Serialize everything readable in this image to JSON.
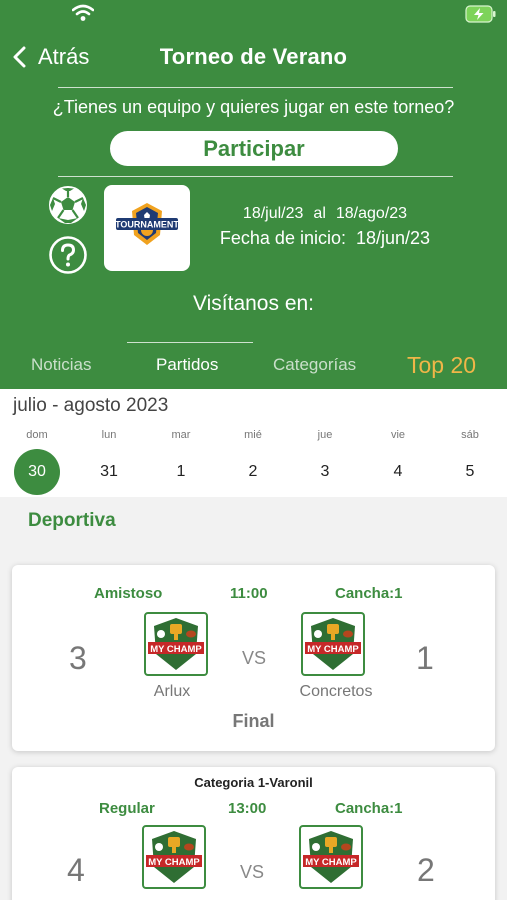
{
  "nav": {
    "back_label": "Atrás",
    "title": "Torneo de Verano"
  },
  "tournament": {
    "question": "¿Tienes un equipo y quieres jugar en este torneo?",
    "participate_label": "Participar",
    "logo_text": "TOURNAMENT",
    "date_from": "18/jul/23",
    "date_sep": "al",
    "date_to": "18/ago/23",
    "start_label": "Fecha de inicio:",
    "start_date": "18/jun/23",
    "visit_label": "Visítanos en:"
  },
  "tabs": [
    {
      "label": "Noticias"
    },
    {
      "label": "Partidos"
    },
    {
      "label": "Categorías"
    },
    {
      "label": "Top 20"
    }
  ],
  "calendar": {
    "month_label": "julio - agosto 2023",
    "weekdays": [
      "dom",
      "lun",
      "mar",
      "mié",
      "jue",
      "vie",
      "sáb"
    ],
    "days": [
      "30",
      "31",
      "1",
      "2",
      "3",
      "4",
      "5"
    ],
    "selected_index": 0
  },
  "section_title": "Deportiva",
  "matches": [
    {
      "category": "",
      "type": "Amistoso",
      "time": "11:00",
      "field": "Cancha:1",
      "home_score": "3",
      "away_score": "1",
      "home_team": "Arlux",
      "away_team": "Concretos",
      "vs": "VS",
      "status": "Final",
      "badge_text": "MY CHAMP"
    },
    {
      "category": "Categoria 1-Varonil",
      "type": "Regular",
      "time": "13:00",
      "field": "Cancha:1",
      "home_score": "4",
      "away_score": "2",
      "home_team": "",
      "away_team": "",
      "vs": "VS",
      "status": "",
      "badge_text": "MY CHAMP"
    }
  ],
  "colors": {
    "primary": "#3d8c40",
    "accent": "#f0b648"
  }
}
